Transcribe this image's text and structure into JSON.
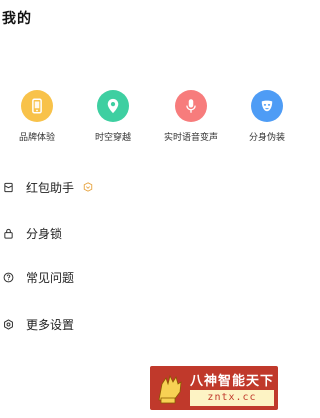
{
  "header": {
    "title": "我的"
  },
  "features": [
    {
      "label": "品牌体验",
      "icon": "phone-icon",
      "color": "#F8C24A"
    },
    {
      "label": "时空穿越",
      "icon": "location-pin-icon",
      "color": "#3ECFA1"
    },
    {
      "label": "实时语音变声",
      "icon": "microphone-icon",
      "color": "#F77C7C"
    },
    {
      "label": "分身伪装",
      "icon": "mask-icon",
      "color": "#4E9CF5"
    }
  ],
  "menu": [
    {
      "label": "红包助手",
      "icon": "red-packet-icon",
      "badge_icon": "vip-shield-icon",
      "badge_color": "#E6A23C"
    },
    {
      "label": "分身锁",
      "icon": "lock-icon"
    },
    {
      "label": "常见问题",
      "icon": "question-icon"
    },
    {
      "label": "更多设置",
      "icon": "settings-icon"
    }
  ],
  "watermark": {
    "title": "八神智能天下",
    "url": "zntx.cc",
    "background": "#C0392B",
    "url_background": "#FDF3C4"
  }
}
